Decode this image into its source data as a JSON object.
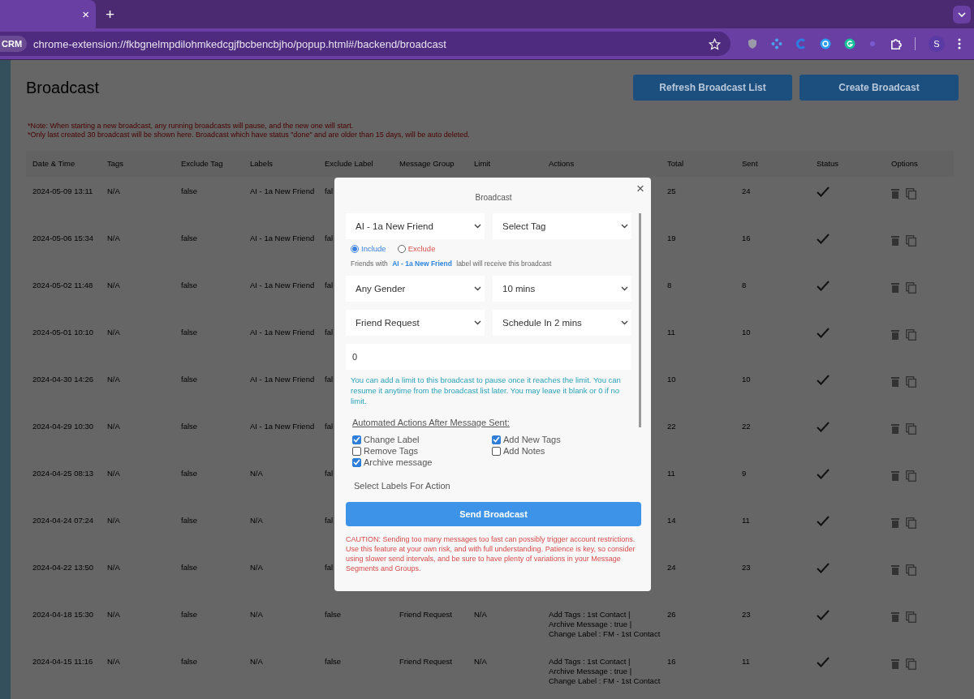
{
  "browser": {
    "tab_close": "×",
    "new_tab": "+",
    "address_chip": "CRM",
    "url": "chrome-extension://fkbgnelmpdilohmkedcgjfbcbencbjho/popup.html#/backend/broadcast",
    "profile": "S"
  },
  "page": {
    "title": "Broadcast",
    "buttons": [
      "Refresh Broadcast List",
      "Create Broadcast"
    ],
    "notes": [
      "*Note: When starting a new broadcast, any running broadcasts will pause, and the new one will start.",
      "*Only last created 30 broadcast will be shown here. Broadcast which have status \"done\" and are older than 15 days, will be auto deleted."
    ]
  },
  "table": {
    "columns": [
      "Date & Time",
      "Tags",
      "Exclude Tag",
      "Labels",
      "Exclude Label",
      "Message Group",
      "Limit",
      "Actions",
      "Total",
      "Sent",
      "Status",
      "Options"
    ],
    "rows": [
      {
        "date": "2024-05-09 13:11",
        "tags": "N/A",
        "exclude_tag": "false",
        "labels": "AI - 1a New Friend",
        "exclude_label": "fal",
        "total": "25",
        "sent": "24",
        "done": true
      },
      {
        "date": "2024-05-06 15:34",
        "tags": "N/A",
        "exclude_tag": "false",
        "labels": "AI - 1a New Friend",
        "exclude_label": "fal",
        "total": "19",
        "sent": "16",
        "done": true
      },
      {
        "date": "2024-05-02 11:48",
        "tags": "N/A",
        "exclude_tag": "false",
        "labels": "AI - 1a New Friend",
        "exclude_label": "fal",
        "total": "8",
        "sent": "8",
        "done": true
      },
      {
        "date": "2024-05-01 10:10",
        "tags": "N/A",
        "exclude_tag": "false",
        "labels": "AI - 1a New Friend",
        "exclude_label": "fal",
        "total": "11",
        "sent": "10",
        "done": true
      },
      {
        "date": "2024-04-30 14:26",
        "tags": "N/A",
        "exclude_tag": "false",
        "labels": "AI - 1a New Friend",
        "exclude_label": "fal",
        "total": "10",
        "sent": "10",
        "done": true
      },
      {
        "date": "2024-04-29 10:30",
        "tags": "N/A",
        "exclude_tag": "false",
        "labels": "AI - 1a New Friend",
        "exclude_label": "fal",
        "total": "22",
        "sent": "22",
        "done": true
      },
      {
        "date": "2024-04-25 08:13",
        "tags": "N/A",
        "exclude_tag": "false",
        "labels": "N/A",
        "exclude_label": "fal",
        "total": "11",
        "sent": "9",
        "done": true
      },
      {
        "date": "2024-04-24 07:24",
        "tags": "N/A",
        "exclude_tag": "false",
        "labels": "N/A",
        "exclude_label": "fal",
        "total": "14",
        "sent": "11",
        "done": true
      },
      {
        "date": "2024-04-22 13:50",
        "tags": "N/A",
        "exclude_tag": "false",
        "labels": "N/A",
        "exclude_label": "fal",
        "total": "24",
        "sent": "23",
        "done": true
      },
      {
        "date": "2024-04-18 15:30",
        "tags": "N/A",
        "exclude_tag": "false",
        "labels": "N/A",
        "exclude_label": "false",
        "message_group": "Friend Request",
        "limit": "N/A",
        "actions": [
          "Add Tags : 1st Contact |",
          "Archive Message : true |",
          "Change Label : FM - 1st Contact"
        ],
        "total": "26",
        "sent": "23",
        "done": true
      },
      {
        "date": "2024-04-15 11:16",
        "tags": "N/A",
        "exclude_tag": "false",
        "labels": "N/A",
        "exclude_label": "false",
        "message_group": "Friend Request",
        "limit": "N/A",
        "actions": [
          "Add Tags : 1st Contact |",
          "Archive Message : true |",
          "Change Label : FM - 1st Contact"
        ],
        "total": "16",
        "sent": "11",
        "done": true
      }
    ]
  },
  "modal": {
    "title": "Broadcast",
    "close": "×",
    "label_select": "AI - 1a New Friend",
    "tag_select": "Select Tag",
    "radios": [
      {
        "label": "Include",
        "selected": true,
        "kind": "include"
      },
      {
        "label": "Exclude",
        "selected": false,
        "kind": "exclude"
      }
    ],
    "info": "Friends with **AI - 1a New Friend** label will receive this broadcast",
    "gender_select": "Any Gender",
    "interval_select": "10 mins",
    "type_select": "Friend Request",
    "schedule_select": "Schedule In 2 mins",
    "limit_value": "0",
    "limit_help": "You can add a limit to this broadcast to pause once it reaches the limit. You can resume it anytime from the broadcast list later. You may leave it blank or 0 if no limit.",
    "actions_heading": "Automated Actions After Message Sent:",
    "checkboxes": [
      {
        "label": "Change Label",
        "checked": true
      },
      {
        "label": "Add New Tags",
        "checked": true
      },
      {
        "label": "Remove Tags",
        "checked": false
      },
      {
        "label": "Add Notes",
        "checked": false
      },
      {
        "label": "Archive message",
        "checked": true
      }
    ],
    "select_labels_heading": "Select Labels For Action",
    "send_button": "Send Broadcast",
    "caution": "CAUTION: Sending too many messages too fast can possibly trigger account restrictions. Use this feature at your own risk, and with full understanding. Patience is key, so consider using slower send intervals, and be sure to have plenty of variations in your Message Segments and Groups."
  }
}
